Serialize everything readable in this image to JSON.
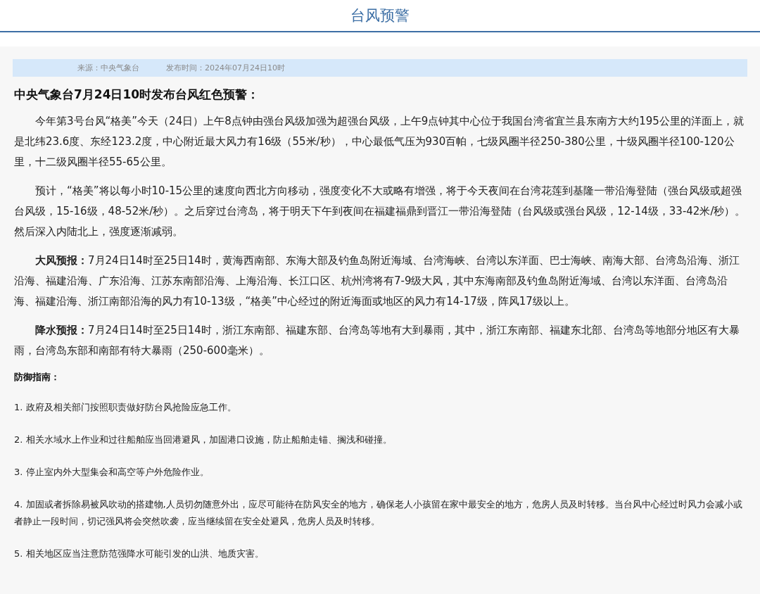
{
  "header": {
    "title": "台风预警"
  },
  "meta": {
    "source": "来源：中央气象台",
    "published": "发布时间：2024年07月24日10时"
  },
  "headline": "中央气象台7月24日10时发布台风红色预警：",
  "paragraphs": [
    "今年第3号台风“格美”今天（24日）上午8点钟由强台风级加强为超强台风级，上午9点钟其中心位于我国台湾省宜兰县东南方大约195公里的洋面上，就是北纬23.6度、东经123.2度，中心附近最大风力有16级（55米/秒），中心最低气压为930百帕，七级风圈半径250-380公里，十级风圈半径100-120公里，十二级风圈半径55-65公里。",
    "预计，“格美”将以每小时10-15公里的速度向西北方向移动，强度变化不大或略有增强，将于今天夜间在台湾花莲到基隆一带沿海登陆（强台风级或超强台风级，15-16级，48-52米/秒）。之后穿过台湾岛，将于明天下午到夜间在福建福鼎到晋江一带沿海登陆（台风级或强台风级，12-14级，33-42米/秒）。然后深入内陆北上，强度逐渐减弱。",
    "**大风预报：**7月24日14时至25日14时，黄海西南部、东海大部及钓鱼岛附近海域、台湾海峡、台湾以东洋面、巴士海峡、南海大部、台湾岛沿海、浙江沿海、福建沿海、广东沿海、江苏东南部沿海、上海沿海、长江口区、杭州湾将有7-9级大风，其中东海南部及钓鱼岛附近海域、台湾以东洋面、台湾岛沿海、福建沿海、浙江南部沿海的风力有10-13级，“格美”中心经过的附近海面或地区的风力有14-17级，阵风17级以上。",
    "**降水预报：**7月24日14时至25日14时，浙江东南部、福建东部、台湾岛等地有大到暴雨，其中，浙江东南部、福建东北部、台湾岛等地部分地区有大暴雨，台湾岛东部和南部有特大暴雨（250-600毫米）。"
  ],
  "guide": {
    "title": "防御指南：",
    "items": [
      "1. 政府及相关部门按照职责做好防台风抢险应急工作。",
      "2. 相关水域水上作业和过往船舶应当回港避风，加固港口设施，防止船舶走锚、搁浅和碰撞。",
      "3. 停止室内外大型集会和高空等户外危险作业。",
      "4. 加固或者拆除易被风吹动的搭建物,人员切勿随意外出，应尽可能待在防风安全的地方，确保老人小孩留在家中最安全的地方，危房人员及时转移。当台风中心经过时风力会减小或者静止一段时间，切记强风将会突然吹袭，应当继续留在安全处避风，危房人员及时转移。",
      "5. 相关地区应当注意防范强降水可能引发的山洪、地质灾害。"
    ]
  }
}
